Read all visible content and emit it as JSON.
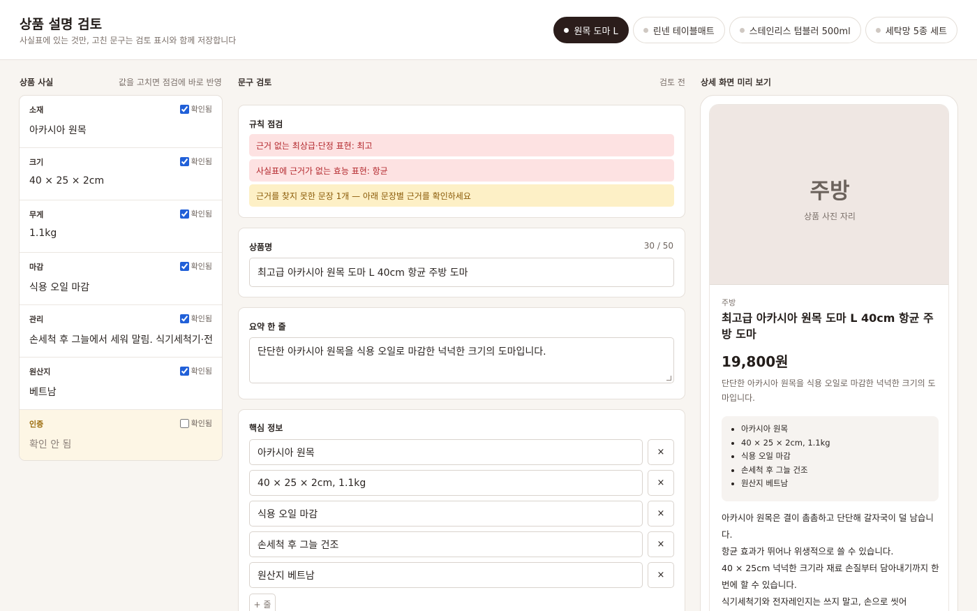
{
  "header": {
    "title": "상품 설명 검토",
    "subtitle": "사실표에 있는 것만, 고친 문구는 검토 표시와 함께 저장합니다",
    "tabs": [
      {
        "label": "원목 도마 L",
        "active": true
      },
      {
        "label": "린넨 테이블매트",
        "active": false
      },
      {
        "label": "스테인리스 텀블러 500ml",
        "active": false
      },
      {
        "label": "세탁망 5종 세트",
        "active": false
      }
    ]
  },
  "facts_panel": {
    "title": "상품 사실",
    "note": "값을 고치면 점검에 바로 반영",
    "items": [
      {
        "label": "소재",
        "value": "아카시아 원목",
        "check_label": "확인됨",
        "checked": true
      },
      {
        "label": "크기",
        "value": "40 × 25 × 2cm",
        "check_label": "확인됨",
        "checked": true
      },
      {
        "label": "무게",
        "value": "1.1kg",
        "check_label": "확인됨",
        "checked": true
      },
      {
        "label": "마감",
        "value": "식용 오일 마감",
        "check_label": "확인됨",
        "checked": true
      },
      {
        "label": "관리",
        "value": "손세척 후 그늘에서 세워 말림. 식기세척기·전자레인지 사용 불가",
        "check_label": "확인됨",
        "checked": true
      },
      {
        "label": "원산지",
        "value": "베트남",
        "check_label": "확인됨",
        "checked": true
      },
      {
        "label": "인증",
        "value": "확인 안 됨",
        "check_label": "확인됨",
        "checked": false
      }
    ]
  },
  "review_panel": {
    "title": "문구 검토",
    "status": "검토 전",
    "rules": {
      "title": "규칙 점검",
      "alerts": [
        {
          "text": "근거 없는 최상급·단정 표현: 최고",
          "level": "error"
        },
        {
          "text": "사실표에 근거가 없는 효능 표현: 항균",
          "level": "error"
        },
        {
          "text": "근거를 찾지 못한 문장 1개 — 아래 문장별 근거를 확인하세요",
          "level": "warning"
        }
      ]
    },
    "product_name": {
      "title": "상품명",
      "counter": "30 / 50",
      "value": "최고급 아카시아 원목 도마 L 40cm 항균 주방 도마"
    },
    "summary": {
      "title": "요약 한 줄",
      "value": "단단한 아카시아 원목을 식용 오일로 마감한 넉넉한 크기의 도마입니다."
    },
    "key_info": {
      "title": "핵심 정보",
      "items": [
        "아카시아 원목",
        "40 × 25 × 2cm, 1.1kg",
        "식용 오일 마감",
        "손세척 후 그늘 건조",
        "원산지 베트남"
      ],
      "remove_label": "×",
      "add_label": "+ 줄"
    }
  },
  "preview_panel": {
    "title": "상세 화면 미리 보기",
    "photo_category": "주방",
    "photo_caption": "상품 사진 자리",
    "category": "주방",
    "name": "최고급 아카시아 원목 도마 L 40cm 항균 주방 도마",
    "price": "19,800원",
    "summary": "단단한 아카시아 원목을 식용 오일로 마감한 넉넉한 크기의 도마입니다.",
    "bullets": [
      "아카시아 원목",
      "40 × 25 × 2cm, 1.1kg",
      "식용 오일 마감",
      "손세척 후 그늘 건조",
      "원산지 베트남"
    ],
    "body": [
      "아카시아 원목은 결이 촘촘하고 단단해 갈자국이 덜 남습니다.",
      "항균 효과가 뛰어나 위생적으로 쓸 수 있습니다.",
      "40 × 25cm 넉넉한 크기라 재료 손질부터 담아내기까지 한 번에 할 수 있습니다.",
      "식기세척기와 전자레인지는 쓰지 말고, 손으로 씻어"
    ]
  },
  "colors": {
    "accent_dark": "#2b1d1b",
    "error_bg": "#fde2e2",
    "error_text": "#b3282d",
    "warning_bg": "#fdf0c6",
    "warning_text": "#8a5a07",
    "page_bg": "#f8f5f1"
  }
}
